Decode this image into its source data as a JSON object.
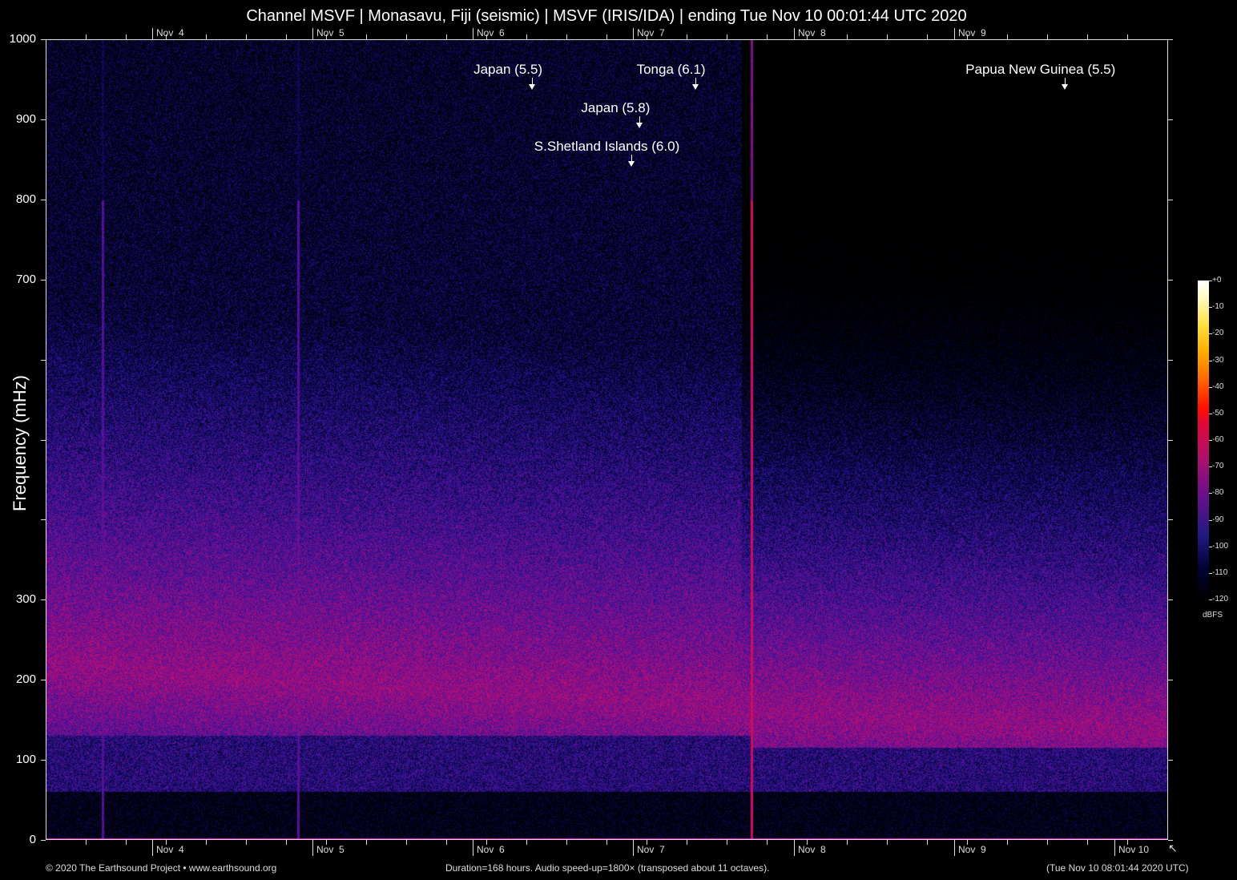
{
  "chart_data": {
    "type": "heatmap",
    "title": "Channel MSVF | Monasavu, Fiji (seismic) | MSVF (IRIS/IDA) | ending Tue Nov 10 00:01:44 UTC 2020",
    "ylabel": "Frequency (mHz)",
    "ylim": [
      0,
      1000
    ],
    "y_ticks": [
      0,
      100,
      200,
      300,
      400,
      500,
      600,
      700,
      800,
      900,
      1000
    ],
    "y_tick_labels": [
      "0",
      "100",
      "200",
      "300",
      "",
      "",
      "",
      "700",
      "800",
      "900",
      "1000"
    ],
    "x_duration_hours": 168,
    "x_day_labels": [
      {
        "label": "Nov  4",
        "hour": 16
      },
      {
        "label": "Nov  5",
        "hour": 40
      },
      {
        "label": "Nov  6",
        "hour": 64
      },
      {
        "label": "Nov  7",
        "hour": 88
      },
      {
        "label": "Nov  8",
        "hour": 112
      },
      {
        "label": "Nov  9",
        "hour": 136
      },
      {
        "label": "Nov 10",
        "hour": 160
      }
    ],
    "x_minor_tick_hours": 6,
    "annotations": [
      {
        "label": "Japan (5.5)",
        "hour": 72.8
      },
      {
        "label": "Tonga (6.1)",
        "hour": 97.2
      },
      {
        "label": "Papua New Guinea (5.5)",
        "hour": 152.5
      },
      {
        "label": "Japan (5.8)",
        "hour": 88.9
      },
      {
        "label": "S.Shetland Islands (6.0)",
        "hour": 87.6
      }
    ],
    "impulse_hours": [
      8.4,
      37.7,
      105.7
    ],
    "colorbar": {
      "unit": "dBFS",
      "range": [
        -120,
        0
      ],
      "ticks": [
        "+0",
        "-10",
        "-20",
        "-30",
        "-40",
        "-50",
        "-60",
        "-70",
        "-80",
        "-90",
        "-100",
        "-110",
        "-120"
      ]
    }
  },
  "footer": {
    "copyright": "© 2020 The Earthsound Project • www.earthsound.org",
    "info": "Duration=168 hours. Audio speed-up=1800× (transposed about 11 octaves).",
    "timestamp": "(Tue Nov 10 08:01:44 2020 UTC)"
  }
}
